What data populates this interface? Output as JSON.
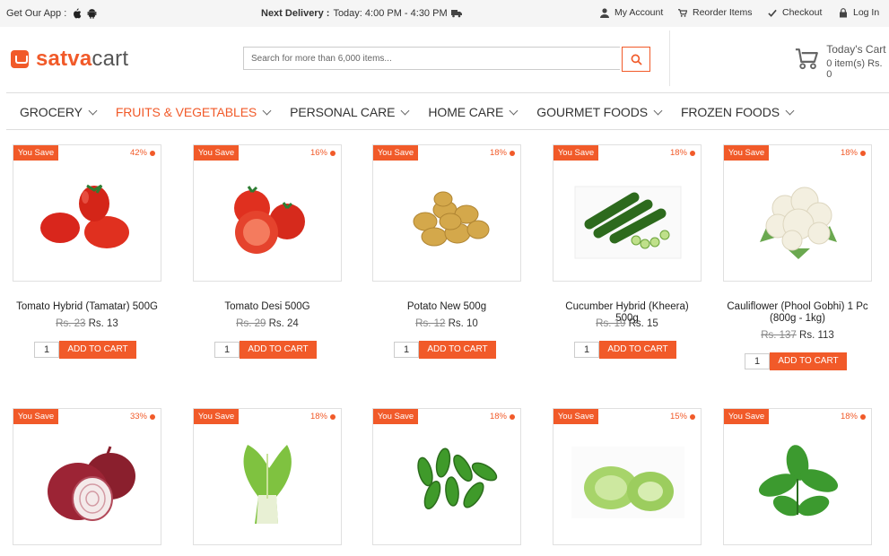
{
  "topbar": {
    "get_app": "Get Our App :",
    "delivery_label": "Next Delivery :",
    "delivery_time": "Today: 4:00 PM - 4:30 PM",
    "links": [
      "My Account",
      "Reorder Items",
      "Checkout",
      "Log In"
    ]
  },
  "logo": {
    "part1": "satva",
    "part2": "cart"
  },
  "search": {
    "placeholder": "Search for more than 6,000 items..."
  },
  "cart": {
    "title": "Today's Cart",
    "summary": "0 item(s) Rs. 0"
  },
  "nav": [
    "GROCERY",
    "FRUITS & VEGETABLES",
    "PERSONAL CARE",
    "HOME CARE",
    "GOURMET FOODS",
    "FROZEN FOODS"
  ],
  "products": [
    {
      "name": "Tomato Hybrid (Tamatar) 500G",
      "old": "Rs. 23",
      "new": "Rs. 13",
      "save": "You Save",
      "pct": "42%",
      "qty": "1",
      "btn": "ADD TO CART"
    },
    {
      "name": "Tomato Desi 500G",
      "old": "Rs. 29",
      "new": "Rs. 24",
      "save": "You Save",
      "pct": "16%",
      "qty": "1",
      "btn": "ADD TO CART"
    },
    {
      "name": "Potato New 500g",
      "old": "Rs. 12",
      "new": "Rs. 10",
      "save": "You Save",
      "pct": "18%",
      "qty": "1",
      "btn": "ADD TO CART"
    },
    {
      "name": "Cucumber Hybrid (Kheera) 500g",
      "old": "Rs. 19",
      "new": "Rs. 15",
      "save": "You Save",
      "pct": "18%",
      "qty": "1",
      "btn": "ADD TO CART"
    },
    {
      "name": "Cauliflower (Phool Gobhi) 1 Pc (800g - 1kg)",
      "old": "Rs. 137",
      "new": "Rs. 113",
      "save": "You Save",
      "pct": "18%",
      "qty": "1",
      "btn": "ADD TO CART"
    },
    {
      "save": "You Save",
      "pct": "33%"
    },
    {
      "save": "You Save",
      "pct": "18%"
    },
    {
      "save": "You Save",
      "pct": "18%"
    },
    {
      "save": "You Save",
      "pct": "15%"
    },
    {
      "save": "You Save",
      "pct": "18%"
    }
  ],
  "colors": {
    "accent": "#f15a29"
  },
  "icons": [
    "apple-icon",
    "android-icon",
    "truck-icon",
    "user-icon",
    "cart-icon",
    "check-icon",
    "lock-icon",
    "search-icon",
    "trolley-icon"
  ]
}
